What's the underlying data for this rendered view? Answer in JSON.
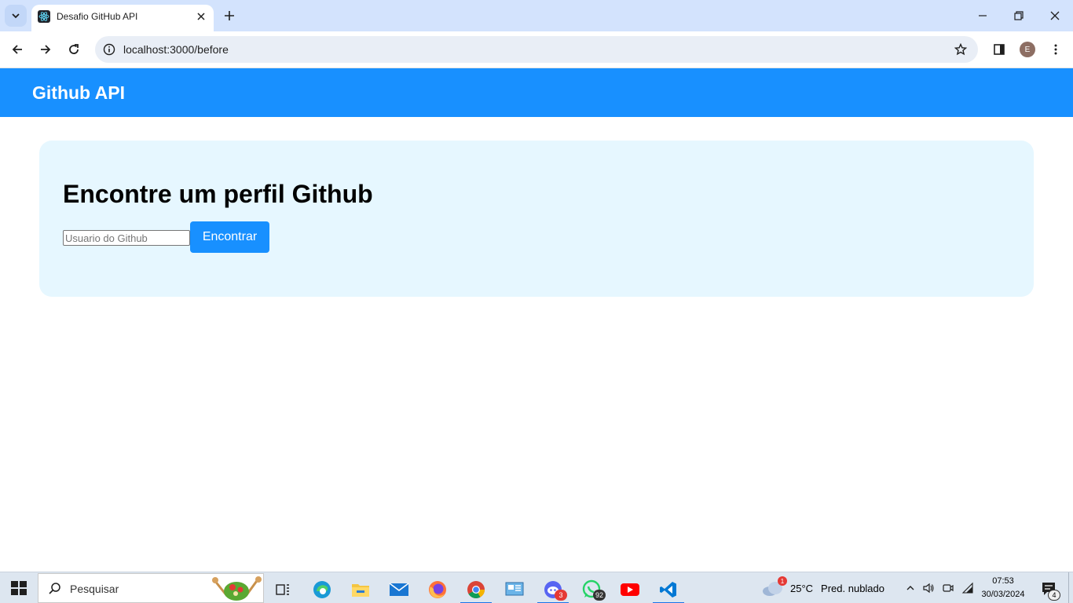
{
  "browser": {
    "tab_title": "Desafio GitHub API",
    "url": "localhost:3000/before",
    "profile_initial": "E"
  },
  "app": {
    "header_title": "Github API",
    "heading": "Encontre um perfil Github",
    "search": {
      "placeholder": "Usuario do Github",
      "value": ""
    },
    "button_label": "Encontrar",
    "colors": {
      "primary": "#1890ff",
      "card_bg": "#e6f7ff"
    }
  },
  "taskbar": {
    "search_placeholder": "Pesquisar",
    "discord_badge": "3",
    "whatsapp_badge": "92",
    "weather_alert": "1",
    "temperature": "25°C",
    "weather_desc": "Pred. nublado",
    "time": "07:53",
    "date": "30/03/2024",
    "notification_count": "4"
  }
}
